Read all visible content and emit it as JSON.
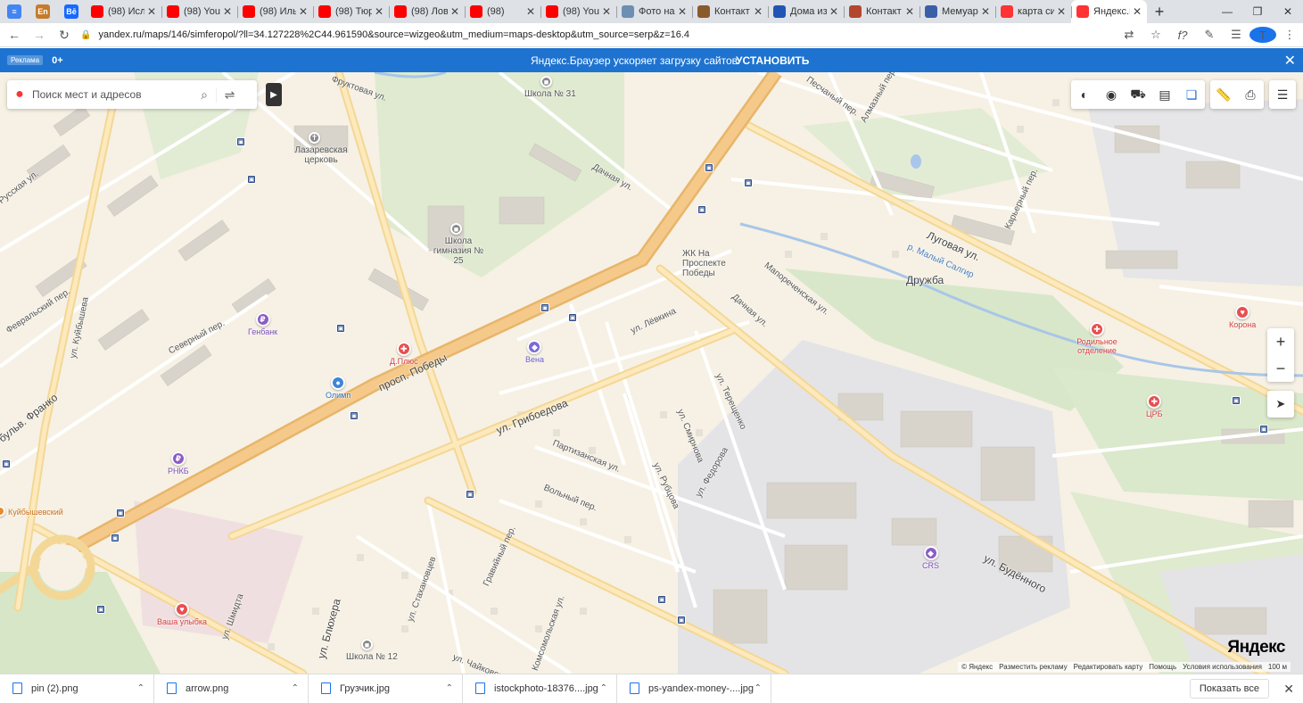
{
  "browser": {
    "small_tabs": [
      {
        "icon": "docs-icon",
        "glyph": "≡",
        "color": "#4285f4"
      },
      {
        "icon": "en-icon",
        "glyph": "En",
        "color": "#c77b2a"
      },
      {
        "icon": "behance-icon",
        "glyph": "Bē",
        "color": "#1769ff"
      }
    ],
    "tabs": [
      {
        "title": "(98) Исла",
        "icon": "youtube-icon",
        "color": "#ff0000"
      },
      {
        "title": "(98) YouT",
        "icon": "youtube-icon",
        "color": "#ff0000"
      },
      {
        "title": "(98) Иль",
        "icon": "youtube-icon",
        "color": "#ff0000"
      },
      {
        "title": "(98) Тюр",
        "icon": "youtube-icon",
        "color": "#ff0000"
      },
      {
        "title": "(98) Лов",
        "icon": "youtube-icon",
        "color": "#ff0000"
      },
      {
        "title": "(98)",
        "icon": "youtube-icon",
        "color": "#ff0000"
      },
      {
        "title": "(98) YouT",
        "icon": "youtube-icon",
        "color": "#ff0000"
      },
      {
        "title": "Фото на",
        "icon": "photo-icon",
        "color": "#6d8fb3"
      },
      {
        "title": "Контакт",
        "icon": "book-icon",
        "color": "#8b5a2b"
      },
      {
        "title": "Дома из",
        "icon": "doc-icon",
        "color": "#2155b5"
      },
      {
        "title": "Контакт",
        "icon": "house-icon",
        "color": "#b3462e"
      },
      {
        "title": "Мемуар",
        "icon": "pause-icon",
        "color": "#3a5fa8"
      },
      {
        "title": "карта си",
        "icon": "yandex-icon",
        "color": "#f33"
      },
      {
        "title": "Яндекс.К",
        "icon": "maps-pin-icon",
        "color": "#f33",
        "active": true
      }
    ],
    "url": "yandex.ru/maps/146/simferopol/?ll=34.127228%2C44.961590&source=wizgeo&utm_medium=maps-desktop&utm_source=serp&z=16.4"
  },
  "promo": {
    "ad_label": "Реклама",
    "age": "0+",
    "message": "Яндекс.Браузер ускоряет загрузку сайтов",
    "cta": "УСТАНОВИТЬ"
  },
  "search": {
    "placeholder": "Поиск мест и адресов"
  },
  "map": {
    "streets": [
      {
        "text": "просп. Победы",
        "big": true
      },
      {
        "text": "ул. Грибоедова",
        "big": true
      },
      {
        "text": "Луговая ул.",
        "big": true
      },
      {
        "text": "ул. Будённого",
        "big": true
      },
      {
        "text": "ул. Куйбышева",
        "big": false
      },
      {
        "text": "бульв. Франко",
        "big": true
      },
      {
        "text": "Северный пер.",
        "big": false
      },
      {
        "text": "Февральский пер.",
        "big": false
      },
      {
        "text": "Дачная ул.",
        "big": false
      },
      {
        "text": "Дачная ул.",
        "big": false
      },
      {
        "text": "Мапореченская ул.",
        "big": false
      },
      {
        "text": "ул. Лёвкина",
        "big": false
      },
      {
        "text": "ул. Терещенко",
        "big": false
      },
      {
        "text": "ул. Смирнова",
        "big": false
      },
      {
        "text": "ул. Федорова",
        "big": false
      },
      {
        "text": "ул. Рубцова",
        "big": false
      },
      {
        "text": "Партизанская ул.",
        "big": false
      },
      {
        "text": "Вольный пер.",
        "big": false
      },
      {
        "text": "Гравийный пер.",
        "big": false
      },
      {
        "text": "ул. Стахановцев",
        "big": false
      },
      {
        "text": "ул. Блюхера",
        "big": false
      },
      {
        "text": "ул. Шмидта",
        "big": false
      },
      {
        "text": "ул. Чайковского",
        "big": false
      },
      {
        "text": "Комсомольская ул.",
        "big": false
      },
      {
        "text": "Фруктовая ул.",
        "big": false
      },
      {
        "text": "Песчаный пер.",
        "big": false
      },
      {
        "text": "Алмазный пер.",
        "big": false
      },
      {
        "text": "Карьерный пер.",
        "big": false
      },
      {
        "text": "р. Малый Салгир",
        "big": false
      },
      {
        "text": "Дружба",
        "big": true
      },
      {
        "text": "ЖК На Проспекте Победы",
        "big": false
      },
      {
        "text": "Лазаревская церковь",
        "big": false
      },
      {
        "text": "Школа гимназия № 25",
        "big": false
      },
      {
        "text": "Школа № 31",
        "big": false
      },
      {
        "text": "Школа № 12",
        "big": false
      },
      {
        "text": "Русская ул.",
        "big": false
      }
    ],
    "pois": [
      {
        "name": "Генбанк",
        "color": "#8b5cc7",
        "glyph": "₽"
      },
      {
        "name": "Д.Плюс",
        "color": "#e84f4f",
        "glyph": "✚"
      },
      {
        "name": "Вена",
        "color": "#7b6ad6",
        "glyph": "◆"
      },
      {
        "name": "Олимп",
        "color": "#3d86d8",
        "glyph": "●"
      },
      {
        "name": "РНКБ",
        "color": "#8b5cc7",
        "glyph": "₽"
      },
      {
        "name": "Куйбышевский",
        "color": "#e8892e",
        "glyph": "●"
      },
      {
        "name": "Ваша улыбка",
        "color": "#e84f4f",
        "glyph": "♥"
      },
      {
        "name": "Родильное отделение",
        "color": "#e84f4f",
        "glyph": "✚"
      },
      {
        "name": "ЦРБ",
        "color": "#e84f4f",
        "glyph": "✚"
      },
      {
        "name": "Корона",
        "color": "#e84f4f",
        "glyph": "♥"
      },
      {
        "name": "CRS",
        "color": "#8b5cc7",
        "glyph": "◆"
      }
    ],
    "logo": "Яндекс",
    "copyright": [
      "© Яндекс",
      "Разместить рекламу",
      "Редактировать карту",
      "Помощь",
      "Условия использования",
      "100 м"
    ]
  },
  "downloads": {
    "items": [
      "pin (2).png",
      "arrow.png",
      "Грузчик.jpg",
      "istockphoto-18376....jpg",
      "ps-yandex-money-....jpg"
    ],
    "show_all": "Показать все"
  }
}
